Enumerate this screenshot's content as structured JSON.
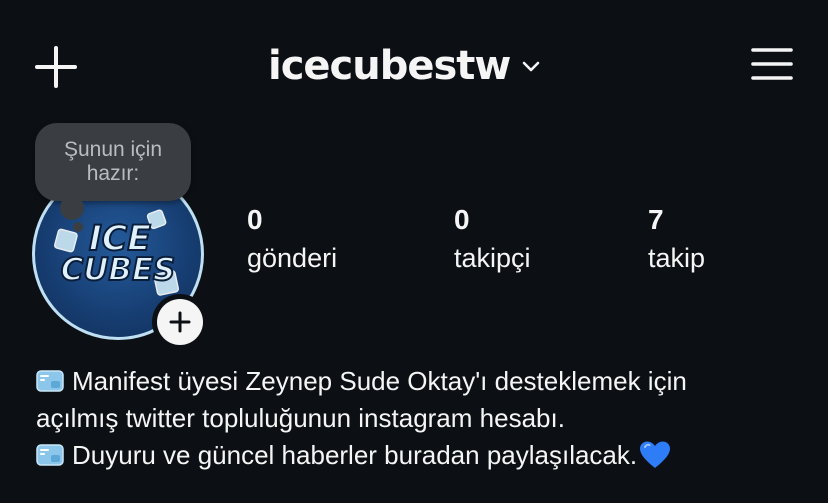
{
  "header": {
    "username": "icecubestw",
    "new_post_icon": "plus-icon",
    "switch_account_icon": "chevron-down-icon",
    "menu_icon": "hamburger-menu-icon"
  },
  "note_bubble": {
    "line1": "Şunun için",
    "line2": "hazır:"
  },
  "profile": {
    "avatar_text_line1": "ICE",
    "avatar_text_line2": "CUBES",
    "add_story_icon": "plus-icon"
  },
  "stats": {
    "posts": {
      "count": "0",
      "label": "gönderi"
    },
    "followers": {
      "count": "0",
      "label": "takipçi"
    },
    "following": {
      "count": "7",
      "label": "takip"
    }
  },
  "bio": {
    "line1": "Manifest üyesi Zeynep Sude Oktay'ı desteklemek için",
    "line2": "açılmış twitter topluluğunun instagram hesabı.",
    "line3": "Duyuru ve güncel haberler buradan paylaşılacak.",
    "cube_emoji": "ice-cube-emoji",
    "heart_emoji": "blue-heart-emoji"
  },
  "colors": {
    "background": "#0c1014",
    "text": "#f5f5f5",
    "bubble": "#3a3d42",
    "bubble_text": "#b9bcc0",
    "avatar_ring": "#bfe0f2",
    "avatar_fill": "#173f74",
    "heart": "#2e7cf6"
  }
}
